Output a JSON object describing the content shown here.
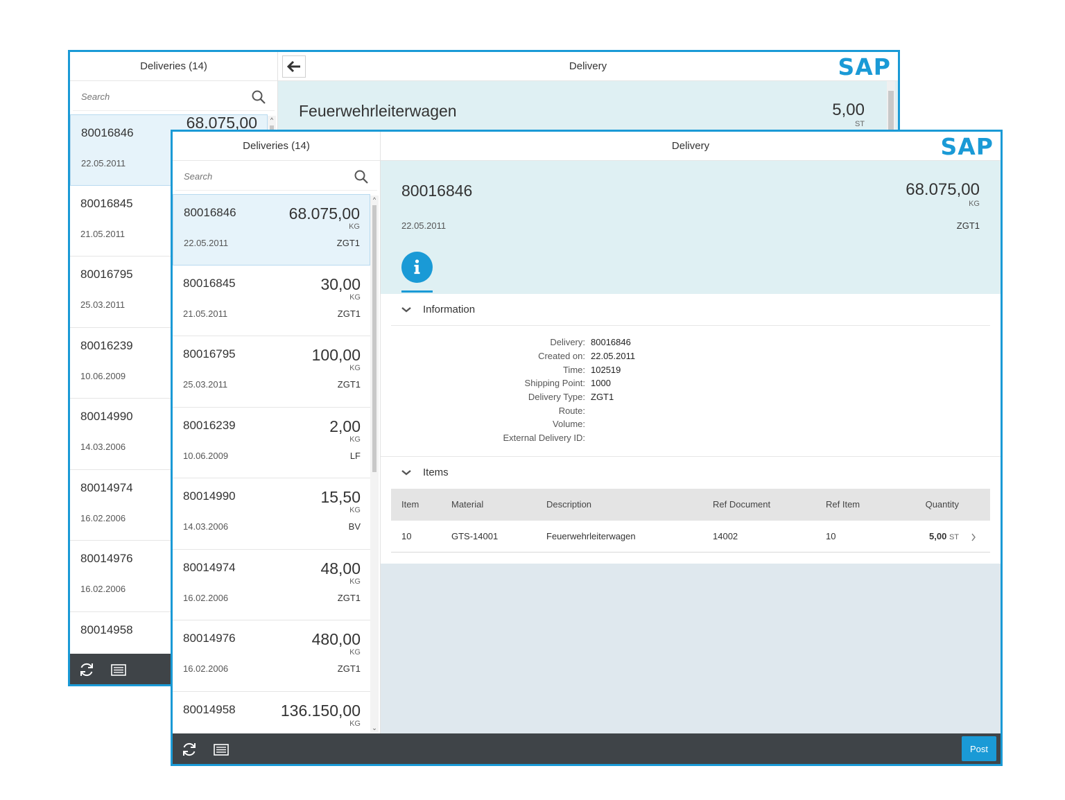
{
  "back_window": {
    "master_title": "Deliveries (14)",
    "search_placeholder": "Search",
    "detail_title": "Delivery",
    "logo": "SAP",
    "header_title": "Feuerwehrleiterwagen",
    "header_number": "5,00",
    "header_unit": "ST",
    "items": [
      {
        "number": "80016846",
        "date": "22.05.2011",
        "amount": "68.075,00"
      },
      {
        "number": "80016845",
        "date": "21.05.2011"
      },
      {
        "number": "80016795",
        "date": "25.03.2011"
      },
      {
        "number": "80016239",
        "date": "10.06.2009"
      },
      {
        "number": "80014990",
        "date": "14.03.2006"
      },
      {
        "number": "80014974",
        "date": "16.02.2006"
      },
      {
        "number": "80014976",
        "date": "16.02.2006"
      },
      {
        "number": "80014958",
        "date": ""
      }
    ]
  },
  "front_window": {
    "master_title": "Deliveries (14)",
    "search_placeholder": "Search",
    "detail_title": "Delivery",
    "logo": "SAP",
    "items": [
      {
        "number": "80016846",
        "date": "22.05.2011",
        "amount": "68.075,00",
        "unit": "KG",
        "type": "ZGT1"
      },
      {
        "number": "80016845",
        "date": "21.05.2011",
        "amount": "30,00",
        "unit": "KG",
        "type": "ZGT1"
      },
      {
        "number": "80016795",
        "date": "25.03.2011",
        "amount": "100,00",
        "unit": "KG",
        "type": "ZGT1"
      },
      {
        "number": "80016239",
        "date": "10.06.2009",
        "amount": "2,00",
        "unit": "KG",
        "type": "LF"
      },
      {
        "number": "80014990",
        "date": "14.03.2006",
        "amount": "15,50",
        "unit": "KG",
        "type": "BV"
      },
      {
        "number": "80014974",
        "date": "16.02.2006",
        "amount": "48,00",
        "unit": "KG",
        "type": "ZGT1"
      },
      {
        "number": "80014976",
        "date": "16.02.2006",
        "amount": "480,00",
        "unit": "KG",
        "type": "ZGT1"
      },
      {
        "number": "80014958",
        "date": "",
        "amount": "136.150,00",
        "unit": "KG",
        "type": ""
      }
    ],
    "header": {
      "title": "80016846",
      "number": "68.075,00",
      "unit": "KG",
      "date": "22.05.2011",
      "type": "ZGT1"
    },
    "info_section": {
      "title": "Information",
      "fields": [
        {
          "label": "Delivery:",
          "value": "80016846"
        },
        {
          "label": "Created on:",
          "value": "22.05.2011"
        },
        {
          "label": "Time:",
          "value": "102519"
        },
        {
          "label": "Shipping Point:",
          "value": "1000"
        },
        {
          "label": "Delivery Type:",
          "value": "ZGT1"
        },
        {
          "label": "Route:",
          "value": ""
        },
        {
          "label": "Volume:",
          "value": ""
        },
        {
          "label": "External Delivery ID:",
          "value": ""
        }
      ]
    },
    "items_section": {
      "title": "Items",
      "columns": [
        "Item",
        "Material",
        "Description",
        "Ref Document",
        "Ref Item",
        "Quantity"
      ],
      "rows": [
        {
          "item": "10",
          "material": "GTS-14001",
          "description": "Feuerwehrleiterwagen",
          "ref_document": "14002",
          "ref_item": "10",
          "quantity": "5,00",
          "unit": "ST"
        }
      ]
    },
    "post_label": "Post"
  },
  "colors": {
    "accent": "#1a9ad6",
    "footer": "#3f4448",
    "header_bg": "#dff0f3",
    "selected": "#e6f3fa"
  },
  "icons": [
    "search-icon",
    "back-arrow-icon",
    "refresh-icon",
    "list-icon",
    "info-icon",
    "chevron-down-icon",
    "chevron-right-icon"
  ]
}
